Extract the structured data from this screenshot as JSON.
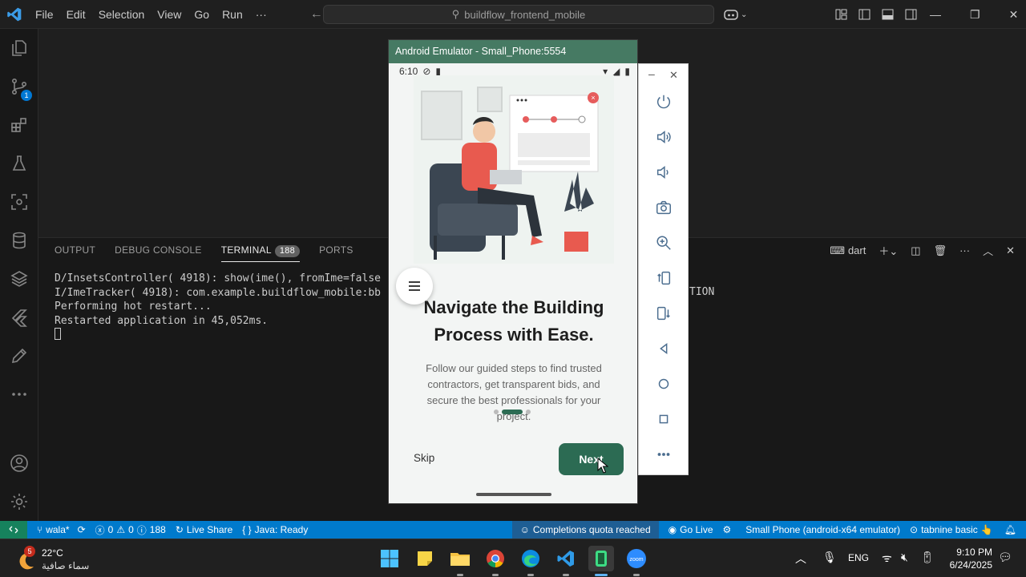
{
  "titlebar": {
    "menu": [
      "File",
      "Edit",
      "Selection",
      "View",
      "Go",
      "Run",
      "···"
    ],
    "search_text": "buildflow_frontend_mobile"
  },
  "activity": {
    "source_control_badge": "1"
  },
  "panel": {
    "tabs": [
      "OUTPUT",
      "DEBUG CONSOLE",
      "TERMINAL",
      "PORTS"
    ],
    "terminal_count": "188",
    "shell_label": "dart",
    "terminal_lines": [
      "D/InsetsController( 4918): show(ime(), fromIme=false",
      "I/ImeTracker( 4918): com.example.buildflow_mobile:bb",
      "",
      "Performing hot restart...",
      "Restarted application in 45,052ms."
    ],
    "terminal_overflow_text": "TION"
  },
  "statusbar": {
    "branch": "wala*",
    "errors": "0",
    "warnings": "0",
    "info": "188",
    "live_share": "Live Share",
    "java": "Java: Ready",
    "quota": "Completions quota reached",
    "go_live": "Go Live",
    "device": "Small Phone (android-x64 emulator)",
    "tabnine": "tabnine basic"
  },
  "emulator": {
    "window_title": "Android Emulator - Small_Phone:5554",
    "time": "6:10",
    "headline": "Navigate the Building Process with Ease.",
    "body": "Follow our guided steps to find trusted contractors, get transparent bids, and secure the best professionals for your project.",
    "skip_label": "Skip",
    "next_label": "Next",
    "page_index": 2,
    "page_count": 3,
    "primary_color": "#2c6b53"
  },
  "taskbar": {
    "weather_temp": "22°C",
    "weather_desc": "سماء صافية",
    "weather_badge": "5",
    "lang": "ENG",
    "time": "9:10 PM",
    "date": "6/24/2025"
  },
  "colors": {
    "statusbar": "#007acc",
    "remote": "#16825d",
    "emulator_title": "#467a63"
  }
}
